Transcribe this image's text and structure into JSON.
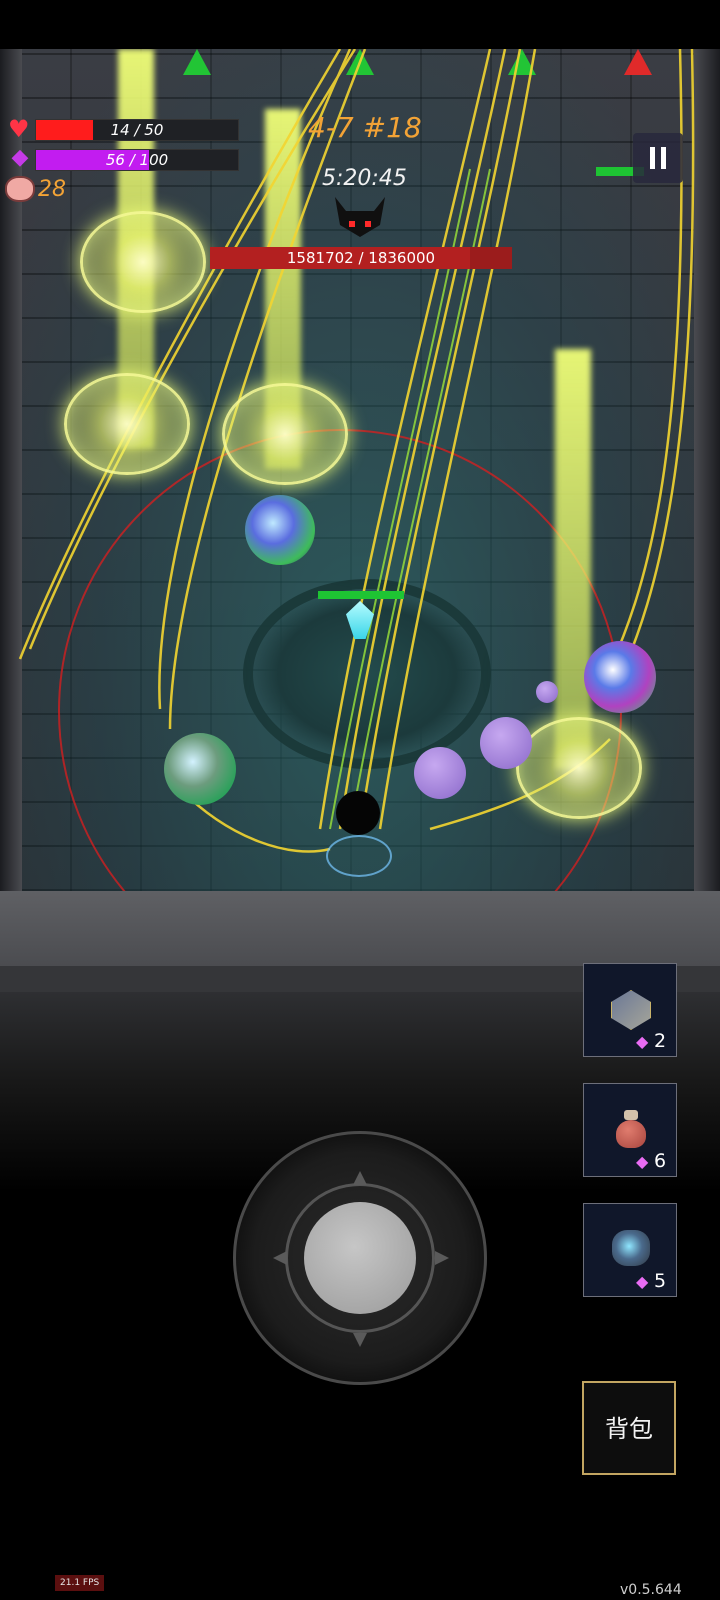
{
  "hud": {
    "hp": {
      "current": 14,
      "max": 50,
      "label": "14 / 50",
      "color": "#ff1c1c"
    },
    "mana": {
      "current": 56,
      "max": 100,
      "label": "56 / 100",
      "color": "#c21cf0"
    },
    "coins": "28",
    "stage": "4-7 #18",
    "timer": "5:20:45"
  },
  "boss": {
    "hp_current": 1581702,
    "hp_max": 1836000,
    "label": "1581702 / 1836000"
  },
  "skills": [
    {
      "icon": "d20-dice-icon",
      "cost": "2"
    },
    {
      "icon": "red-vase-icon",
      "cost": "6"
    },
    {
      "icon": "crystal-orb-icon",
      "cost": "5"
    }
  ],
  "bag_label": "背包",
  "fps": "21.1 FPS",
  "version": "v0.5.644",
  "direction_markers": [
    "green",
    "green",
    "green",
    "red"
  ]
}
